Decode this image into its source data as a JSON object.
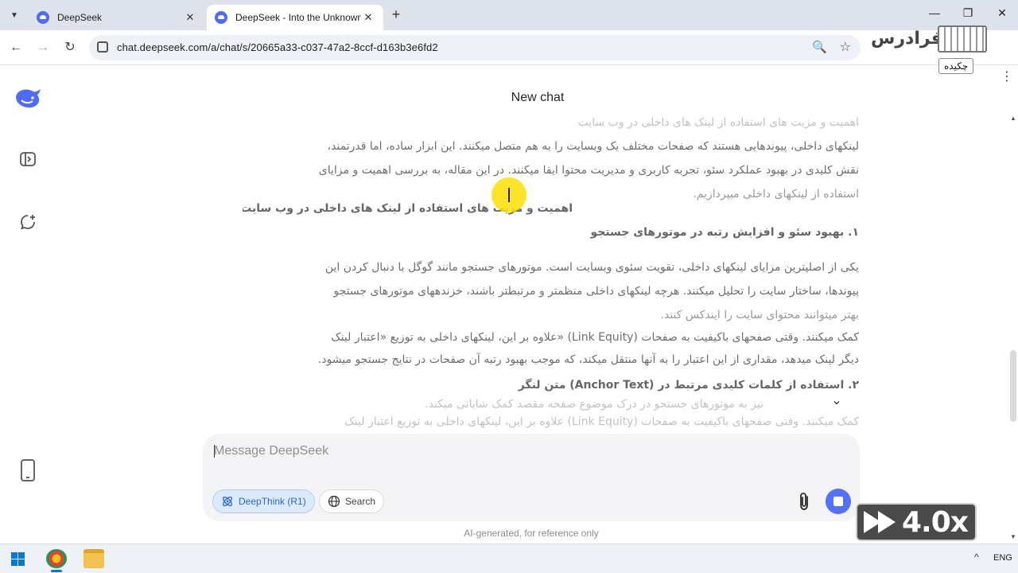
{
  "browser": {
    "tabs": [
      {
        "title": "DeepSeek",
        "active": false
      },
      {
        "title": "DeepSeek - Into the Unknown",
        "active": true
      }
    ],
    "url": "chat.deepseek.com/a/chat/s/20665a33-c037-47a2-8ccf-d163b3e6fd2",
    "new_tab_label": "+",
    "window_controls": {
      "minimize": "—",
      "maximize": "❐",
      "close": "✕"
    },
    "overlay_logo_word": "فرادرس",
    "overlay_tag": "چکیده"
  },
  "rail": {
    "icons": [
      "deepseek-logo",
      "sidebar-toggle-icon",
      "new-chat-icon",
      "phone-icon"
    ]
  },
  "main": {
    "title": "New chat",
    "scroll_down_icon": "chevron-down-icon",
    "ghost_lines": [
      "اهمیت و مزیت های استفاده از لینک های داخلی در وب سایت",
      "لینکهای داخلی، پیوندهایی هستند که صفحات مختلف یک وبسایت را به هم متصل میکنند. این ابزار ساده، اما قدرتمند،",
      "نقش کلیدی در بهبود عملکرد سئو، تجربه کاربری و مدیریت محتوا ایفا میکنند. در این مقاله، به بررسی اهمیت و مزایای",
      "استفاده از لینکهای داخلی میپردازیم.",
      "اهمیت و مزیت های استفاده از لینک های داخلی در وب سایت",
      "۱. بهبود سئو و افزایش رتبه در موتورهای جستجو",
      "یکی از اصلیترین مزایای لینکهای داخلی، تقویت سئوی وبسایت است. موتورهای جستجو مانند گوگل با دنبال کردن این",
      "پیوندها، ساختار سایت را تحلیل میکنند. هرچه لینکهای داخلی منظمتر و مرتبطتر باشند، خزندههای موتورهای جستجو",
      "بهتر میتوانند محتوای سایت را ایندکس کنند.",
      "کمک میکنند. وقتی صفحهای باکیفیت به صفحات (Link Equity) «علاوه بر این، لینکهای داخلی به توزیع «اعتبار لینک",
      "دیگر لینک میدهد، مقداری از این اعتبار را به آنها منتقل میکند، که موجب بهبود رتبه آن صفحات در نتایج جستجو میشود.",
      "۲. استفاده از کلمات کلیدی مرتبط در (Anchor Text) متن لنگر",
      "نیز به موتورهای جستجو در درک موضوع صفحه مقصد کمک شایانی میکند.",
      "کمک میکنند. وقتی صفحهای باکیفیت به صفحات (Link Equity) علاوه بر این، لینکهای داخلی به توزیع اعتبار لینک"
    ]
  },
  "composer": {
    "placeholder": "Message DeepSeek",
    "deepthink_label": "DeepThink (R1)",
    "search_label": "Search",
    "attach_icon": "paperclip-icon",
    "stop_icon": "stop-icon",
    "accent": "#4d6bfe"
  },
  "footer": {
    "disclaimer": "AI-generated, for reference only"
  },
  "overlay": {
    "speed_label": "4.0x"
  },
  "taskbar": {
    "language": "ENG",
    "tray_chevron": "^"
  }
}
